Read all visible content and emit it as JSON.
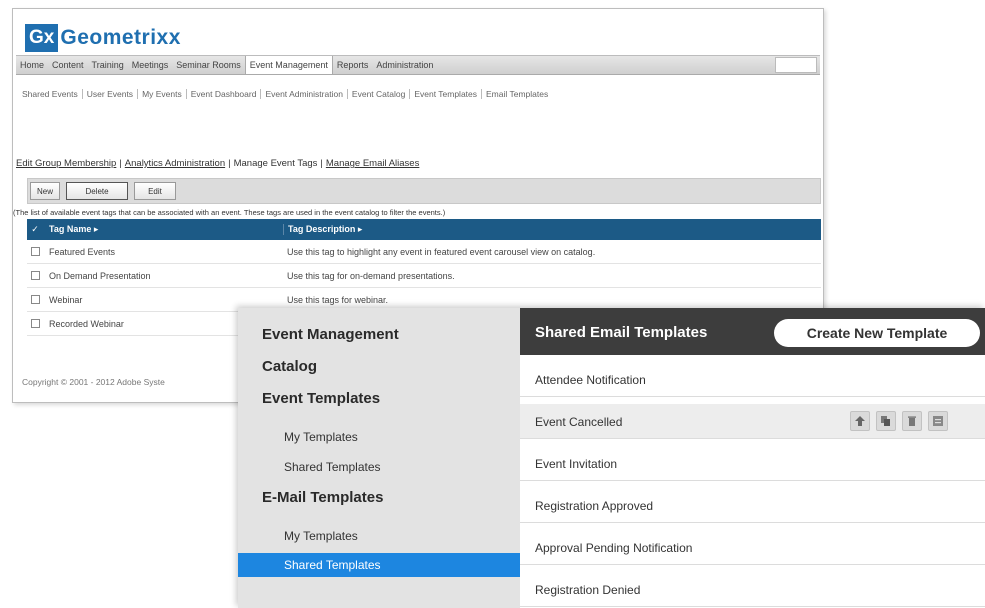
{
  "back_window": {
    "logo": {
      "mark": "Gx",
      "name": "Geometrixx"
    },
    "top_nav": [
      "Home",
      "Content",
      "Training",
      "Meetings",
      "Seminar Rooms",
      "Event Management",
      "Reports",
      "Administration"
    ],
    "top_nav_active": "Event Management",
    "sub_nav": [
      "Shared Events",
      "User Events",
      "My Events",
      "Event Dashboard",
      "Event Administration",
      "Event Catalog",
      "Event Templates",
      "Email Templates"
    ],
    "admin_links": [
      "Edit Group Membership",
      "Analytics Administration",
      "Manage Event Tags",
      "Manage Email Aliases"
    ],
    "admin_links_current": "Manage Event Tags",
    "buttons": {
      "new": "New",
      "delete": "Delete",
      "edit": "Edit"
    },
    "help_text": "(The list of available event tags that can be associated with an event. These tags are used in the event catalog to filter the events.)",
    "table": {
      "headers": {
        "name": "Tag Name ▸",
        "description": "Tag Description ▸"
      },
      "rows": [
        {
          "name": "Featured Events",
          "description": "Use this tag to highlight any event in featured event carousel view on catalog."
        },
        {
          "name": "On Demand Presentation",
          "description": "Use this tag for on-demand presentations."
        },
        {
          "name": "Webinar",
          "description": "Use this tags for webinar."
        },
        {
          "name": "Recorded Webinar",
          "description": ""
        }
      ]
    },
    "copyright": "Copyright © 2001 - 2012 Adobe Syste"
  },
  "front_panel": {
    "sidebar": {
      "event_management": "Event Management",
      "catalog": "Catalog",
      "event_templates": "Event Templates",
      "event_my_templates": "My Templates",
      "event_shared_templates": "Shared Templates",
      "email_templates": "E-Mail Templates",
      "email_my_templates": "My Templates",
      "email_shared_templates": "Shared Templates"
    },
    "header": {
      "title": "Shared Email Templates",
      "create_button": "Create New Template"
    },
    "templates": [
      "Attendee Notification",
      "Event Cancelled",
      "Event Invitation",
      "Registration Approved",
      "Approval Pending Notification",
      "Registration Denied"
    ],
    "hovered_template": "Event Cancelled",
    "row_action_icons": [
      "publish-icon",
      "copy-icon",
      "delete-icon",
      "preview-icon"
    ],
    "colors": {
      "selected": "#1d86e0",
      "header_bg": "#3d3d3d",
      "table_header": "#1c5a86",
      "brand": "#1f6fb0"
    }
  }
}
